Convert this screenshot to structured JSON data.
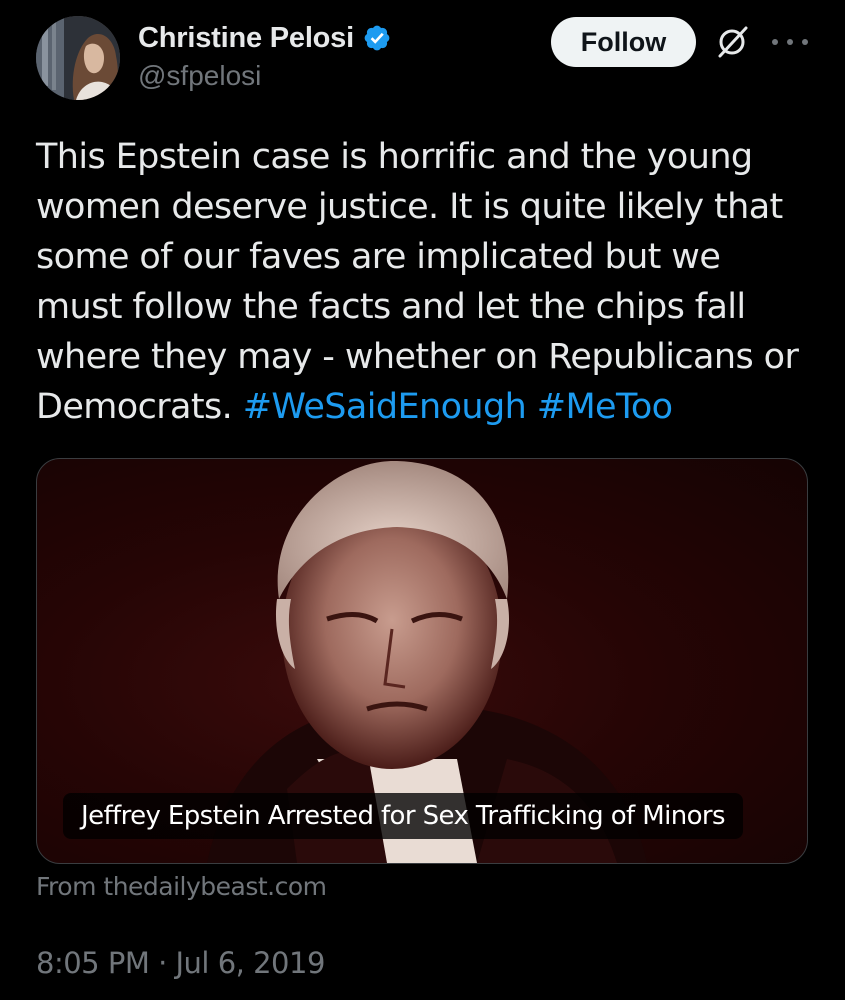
{
  "author": {
    "display_name": "Christine Pelosi",
    "handle": "@sfpelosi",
    "verified": true,
    "avatar_icon": "profile-photo"
  },
  "actions": {
    "follow_label": "Follow",
    "grok_icon": "grok-icon",
    "more_icon": "more-icon"
  },
  "tweet": {
    "text": "This Epstein case is horrific and the young women deserve justice. It is quite likely that some of our faves are implicated but we must follow the facts and let the chips fall where they may - whether on Republicans or Democrats. ",
    "hashtags": [
      "#WeSaidEnough",
      "#MeToo"
    ]
  },
  "card": {
    "caption": "Jeffrey Epstein Arrested for Sex Trafficking of Minors",
    "source": "From thedailybeast.com"
  },
  "timestamp": "8:05 PM · Jul 6, 2019",
  "colors": {
    "background": "#000000",
    "text": "#e7e9ea",
    "secondary": "#71767b",
    "link": "#1d9bf0",
    "verified": "#1d9bf0",
    "follow_bg": "#eff3f4"
  }
}
